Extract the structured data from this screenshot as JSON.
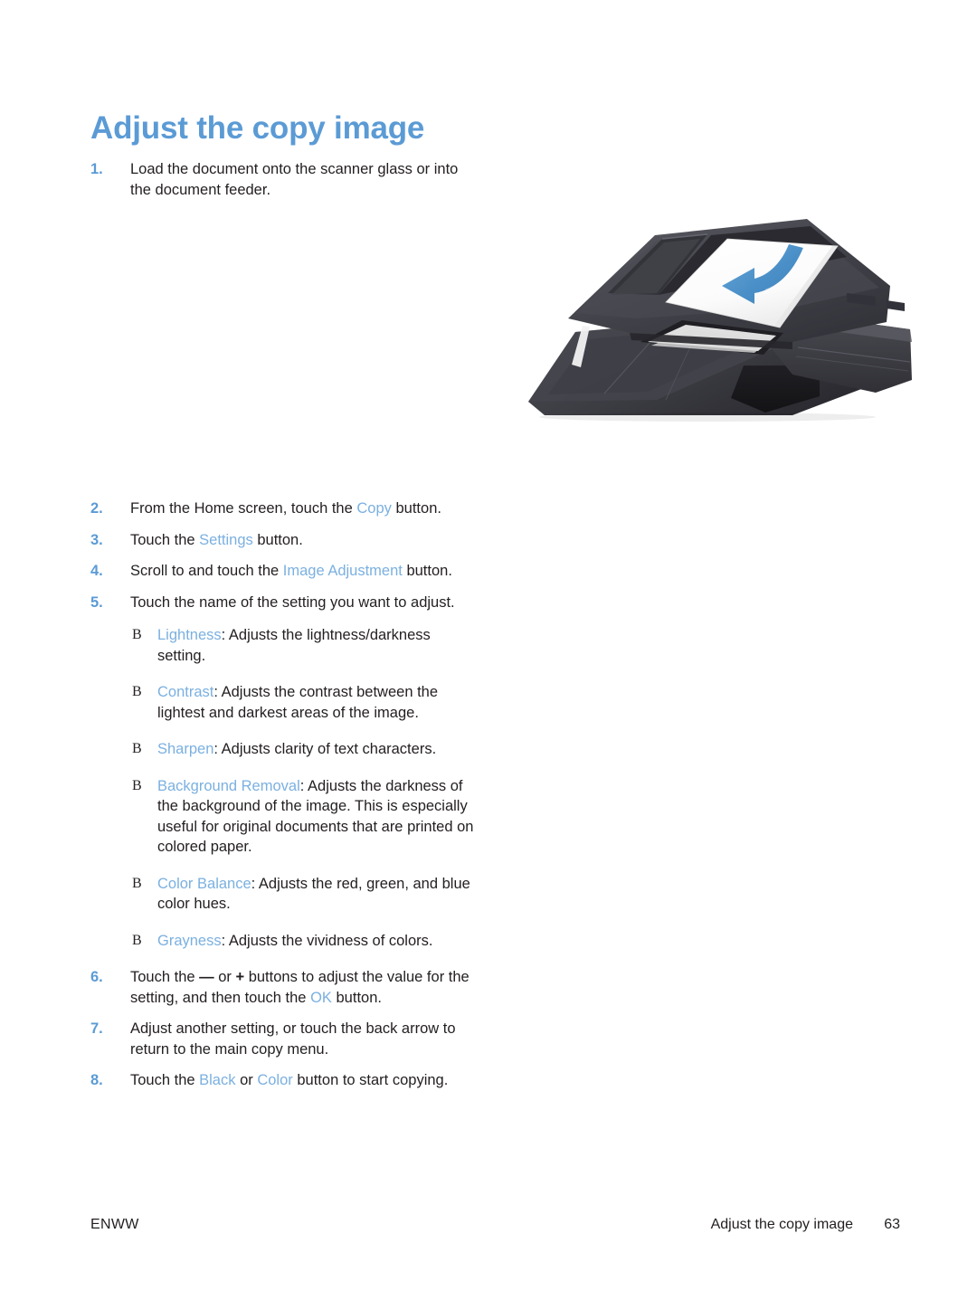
{
  "document": {
    "title": "Adjust the copy image",
    "heading_color": "#5b9bd5",
    "ui_term_color": "#7bb0e0",
    "body_text_color": "#231f20"
  },
  "steps": [
    {
      "number": "1.",
      "parts": [
        {
          "text": "Load the document onto the scanner glass or into the document feeder.",
          "style": "plain"
        }
      ]
    },
    {
      "number": "2.",
      "parts": [
        {
          "text": "From the Home screen, touch the ",
          "style": "plain"
        },
        {
          "text": "Copy",
          "style": "ui"
        },
        {
          "text": " button.",
          "style": "plain"
        }
      ]
    },
    {
      "number": "3.",
      "parts": [
        {
          "text": "Touch the ",
          "style": "plain"
        },
        {
          "text": "Settings",
          "style": "ui"
        },
        {
          "text": " button.",
          "style": "plain"
        }
      ]
    },
    {
      "number": "4.",
      "parts": [
        {
          "text": "Scroll to and touch the ",
          "style": "plain"
        },
        {
          "text": "Image Adjustment",
          "style": "ui"
        },
        {
          "text": " button.",
          "style": "plain"
        }
      ]
    },
    {
      "number": "5.",
      "parts": [
        {
          "text": "Touch the name of the setting you want to adjust.",
          "style": "plain"
        }
      ]
    },
    {
      "number": "6.",
      "parts": [
        {
          "text": "Touch the ",
          "style": "plain"
        },
        {
          "text": "—",
          "style": "symbol"
        },
        {
          "text": " or ",
          "style": "plain"
        },
        {
          "text": "+",
          "style": "symbol"
        },
        {
          "text": " buttons to adjust the value for the setting, and then touch the ",
          "style": "plain"
        },
        {
          "text": "OK",
          "style": "ui"
        },
        {
          "text": " button.",
          "style": "plain"
        }
      ]
    },
    {
      "number": "7.",
      "parts": [
        {
          "text": "Adjust another setting, or touch the back arrow to return to the main copy menu.",
          "style": "plain"
        }
      ]
    },
    {
      "number": "8.",
      "parts": [
        {
          "text": "Touch the ",
          "style": "plain"
        },
        {
          "text": "Black",
          "style": "ui"
        },
        {
          "text": " or ",
          "style": "plain"
        },
        {
          "text": "Color",
          "style": "ui"
        },
        {
          "text": " button to start copying.",
          "style": "plain"
        }
      ]
    }
  ],
  "settings_bullets": {
    "bullet_glyph": "B",
    "items": [
      {
        "name": "Lightness",
        "description": ": Adjusts the lightness/darkness setting."
      },
      {
        "name": "Contrast",
        "description": ": Adjusts the contrast between the lightest and darkest areas of the image."
      },
      {
        "name": "Sharpen",
        "description": ": Adjusts clarity of text characters."
      },
      {
        "name": "Background Removal",
        "description": ": Adjusts the darkness of the background of the image. This is especially useful for original documents that are printed on colored paper."
      },
      {
        "name": "Color Balance",
        "description": ": Adjusts the red, green, and blue color hues."
      },
      {
        "name": "Grayness",
        "description": ": Adjusts the vividness of colors."
      }
    ]
  },
  "illustration": {
    "alt": "printer-document-feeder-loading",
    "arrow_color": "#4a8fc7",
    "body_color": "#3f3f45",
    "paper_color": "#ffffff"
  },
  "footer": {
    "left": "ENWW",
    "section": "Adjust the copy image",
    "page_number": "63"
  }
}
